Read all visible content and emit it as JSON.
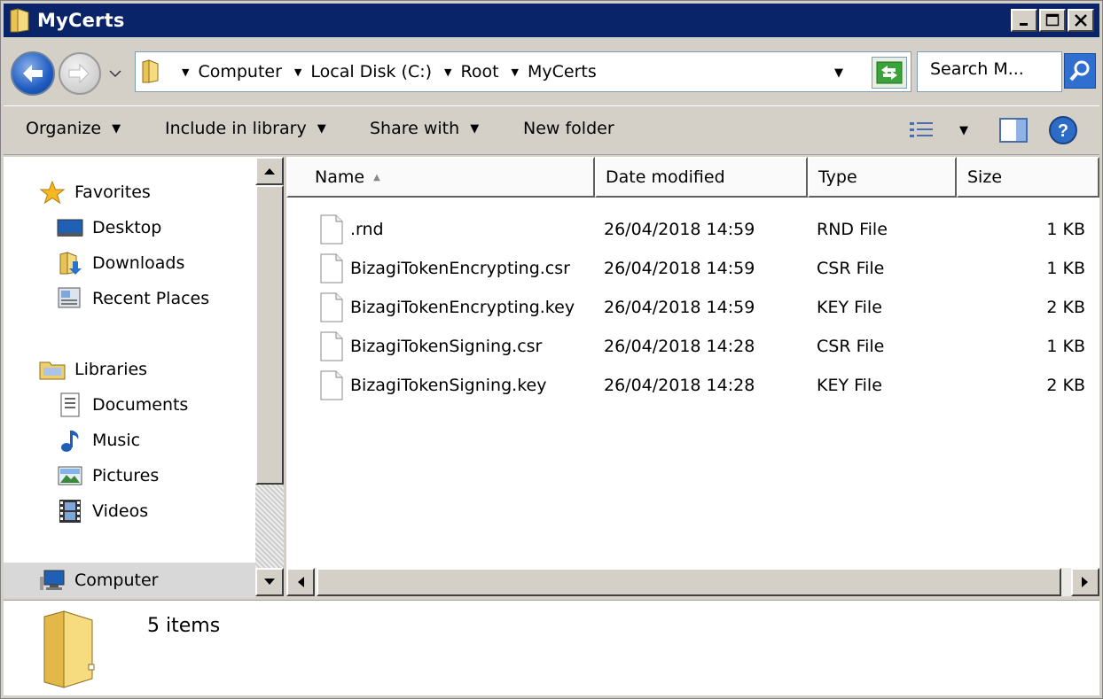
{
  "window": {
    "title": "MyCerts",
    "title_bar_color": "#0a246a",
    "controls": [
      "minimize-icon",
      "maximize-icon",
      "close-icon"
    ]
  },
  "address_bar": {
    "breadcrumbs": [
      "Computer",
      "Local Disk (C:)",
      "Root",
      "MyCerts"
    ],
    "search_placeholder": "Search M..."
  },
  "toolbar": {
    "organize_label": "Organize",
    "include_label": "Include in library",
    "share_label": "Share with",
    "new_folder_label": "New folder"
  },
  "navigation": {
    "favorites_label": "Favorites",
    "favorites": [
      {
        "label": "Desktop",
        "icon": "desktop-icon"
      },
      {
        "label": "Downloads",
        "icon": "downloads-icon"
      },
      {
        "label": "Recent Places",
        "icon": "recent-places-icon"
      }
    ],
    "libraries_label": "Libraries",
    "libraries": [
      {
        "label": "Documents",
        "icon": "documents-icon"
      },
      {
        "label": "Music",
        "icon": "music-icon"
      },
      {
        "label": "Pictures",
        "icon": "pictures-icon"
      },
      {
        "label": "Videos",
        "icon": "videos-icon"
      }
    ],
    "computer_label": "Computer"
  },
  "file_list": {
    "columns": [
      "Name",
      "Date modified",
      "Type",
      "Size"
    ],
    "files": [
      {
        "name": ".rnd",
        "date": "26/04/2018 14:59",
        "type": "RND File",
        "size": "1 KB"
      },
      {
        "name": "BizagiTokenEncrypting.csr",
        "date": "26/04/2018 14:59",
        "type": "CSR File",
        "size": "1 KB"
      },
      {
        "name": "BizagiTokenEncrypting.key",
        "date": "26/04/2018 14:59",
        "type": "KEY File",
        "size": "2 KB"
      },
      {
        "name": "BizagiTokenSigning.csr",
        "date": "26/04/2018 14:28",
        "type": "CSR File",
        "size": "1 KB"
      },
      {
        "name": "BizagiTokenSigning.key",
        "date": "26/04/2018 14:28",
        "type": "KEY File",
        "size": "2 KB"
      }
    ]
  },
  "status_bar": {
    "item_count": "5 items"
  }
}
